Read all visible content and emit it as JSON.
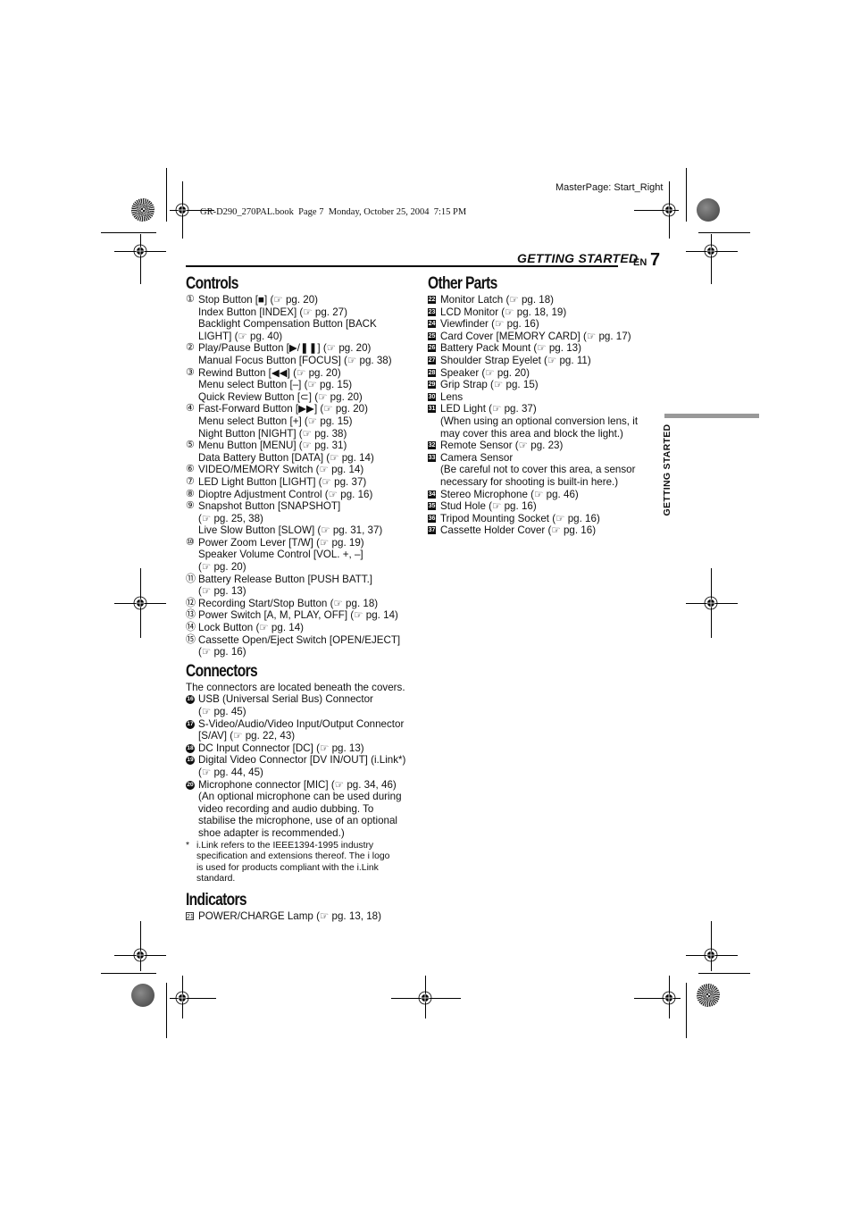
{
  "print_meta": {
    "masterpage": "MasterPage: Start_Right",
    "book_info": "GR-D290_270PAL.book  Page 7  Monday, October 25, 2004  7:15 PM"
  },
  "header": {
    "section": "GETTING STARTED",
    "lang": "EN",
    "page_number": "7"
  },
  "side_tab": {
    "label": "GETTING STARTED"
  },
  "ref_icon": "pointing-hand-icon",
  "controls": {
    "title": "Controls",
    "items": [
      {
        "num": "①",
        "lines": [
          "Stop Button [■] (☞ pg. 20)",
          "Index Button [INDEX] (☞ pg. 27)",
          "Backlight Compensation Button [BACK",
          "LIGHT] (☞ pg. 40)"
        ]
      },
      {
        "num": "②",
        "lines": [
          "Play/Pause Button [▶/❚❚] (☞ pg. 20)",
          "Manual Focus Button [FOCUS] (☞ pg. 38)"
        ]
      },
      {
        "num": "③",
        "lines": [
          "Rewind Button [◀◀] (☞ pg. 20)",
          "Menu select Button [–] (☞ pg. 15)",
          "Quick Review Button [⊂] (☞ pg. 20)"
        ]
      },
      {
        "num": "④",
        "lines": [
          "Fast-Forward Button [▶▶] (☞ pg. 20)",
          "Menu select Button [+] (☞ pg. 15)",
          "Night Button [NIGHT] (☞ pg. 38)"
        ]
      },
      {
        "num": "⑤",
        "lines": [
          "Menu Button [MENU] (☞ pg. 31)",
          "Data Battery Button [DATA] (☞ pg. 14)"
        ]
      },
      {
        "num": "⑥",
        "lines": [
          "VIDEO/MEMORY Switch (☞ pg. 14)"
        ]
      },
      {
        "num": "⑦",
        "lines": [
          "LED Light Button [LIGHT] (☞ pg. 37)"
        ]
      },
      {
        "num": "⑧",
        "lines": [
          "Dioptre Adjustment Control (☞ pg. 16)"
        ]
      },
      {
        "num": "⑨",
        "lines": [
          "Snapshot Button [SNAPSHOT]",
          "(☞ pg. 25, 38)",
          "Live Slow Button [SLOW] (☞ pg. 31, 37)"
        ]
      },
      {
        "num": "⑩",
        "lines": [
          "Power Zoom Lever [T/W] (☞ pg. 19)",
          "Speaker Volume Control [VOL. +, –]",
          "(☞ pg. 20)"
        ]
      },
      {
        "num": "⑪",
        "lines": [
          "Battery Release Button [PUSH BATT.]",
          "(☞ pg. 13)"
        ]
      },
      {
        "num": "⑫",
        "lines": [
          "Recording Start/Stop Button (☞ pg. 18)"
        ]
      },
      {
        "num": "⑬",
        "lines": [
          "Power Switch [A, M, PLAY, OFF] (☞ pg. 14)"
        ]
      },
      {
        "num": "⑭",
        "lines": [
          "Lock Button (☞ pg. 14)"
        ]
      },
      {
        "num": "⑮",
        "lines": [
          "Cassette Open/Eject Switch [OPEN/EJECT]",
          "(☞ pg. 16)"
        ]
      }
    ]
  },
  "connectors": {
    "title": "Connectors",
    "intro": "The connectors are located beneath the covers.",
    "items": [
      {
        "num": "16",
        "lines": [
          "USB (Universal Serial Bus) Connector",
          "(☞ pg. 45)"
        ]
      },
      {
        "num": "17",
        "lines": [
          "S-Video/Audio/Video Input/Output Connector",
          "[S/AV] (☞ pg. 22, 43)"
        ]
      },
      {
        "num": "18",
        "lines": [
          "DC Input Connector [DC] (☞ pg. 13)"
        ]
      },
      {
        "num": "19",
        "lines": [
          "Digital Video Connector [DV IN/OUT] (i.Link*)",
          "(☞ pg. 44, 45)"
        ]
      },
      {
        "num": "20",
        "lines": [
          "Microphone connector [MIC] (☞ pg. 34, 46)",
          "(An optional microphone can be used during",
          "video recording and audio dubbing. To",
          "stabilise the microphone, use of an optional",
          "shoe adapter is recommended.)"
        ]
      }
    ],
    "footnote": {
      "mark": "*",
      "lines": [
        "i.Link refers to the IEEE1394-1995 industry",
        "specification and extensions thereof. The i logo",
        "is used for products compliant with the i.Link",
        "standard."
      ]
    }
  },
  "indicators": {
    "title": "Indicators",
    "items": [
      {
        "num": "21",
        "lines": [
          "POWER/CHARGE Lamp (☞ pg. 13, 18)"
        ]
      }
    ]
  },
  "other_parts": {
    "title": "Other Parts",
    "items": [
      {
        "num": "22",
        "lines": [
          "Monitor Latch (☞ pg. 18)"
        ]
      },
      {
        "num": "23",
        "lines": [
          "LCD Monitor (☞ pg. 18, 19)"
        ]
      },
      {
        "num": "24",
        "lines": [
          "Viewfinder (☞ pg. 16)"
        ]
      },
      {
        "num": "25",
        "lines": [
          "Card Cover [MEMORY CARD] (☞ pg. 17)"
        ]
      },
      {
        "num": "26",
        "lines": [
          "Battery Pack Mount (☞ pg. 13)"
        ]
      },
      {
        "num": "27",
        "lines": [
          "Shoulder Strap Eyelet (☞ pg. 11)"
        ]
      },
      {
        "num": "28",
        "lines": [
          "Speaker (☞ pg. 20)"
        ]
      },
      {
        "num": "29",
        "lines": [
          "Grip Strap (☞ pg. 15)"
        ]
      },
      {
        "num": "30",
        "lines": [
          "Lens"
        ]
      },
      {
        "num": "31",
        "lines": [
          "LED Light (☞ pg. 37)",
          "(When using an optional conversion lens, it",
          "may cover this area and block the light.)"
        ]
      },
      {
        "num": "32",
        "lines": [
          "Remote Sensor (☞ pg. 23)"
        ]
      },
      {
        "num": "33",
        "lines": [
          "Camera Sensor",
          "(Be careful not to cover this area, a sensor",
          "necessary for shooting is built-in here.)"
        ]
      },
      {
        "num": "34",
        "lines": [
          "Stereo Microphone (☞ pg. 46)"
        ]
      },
      {
        "num": "35",
        "lines": [
          "Stud Hole (☞ pg. 16)"
        ]
      },
      {
        "num": "36",
        "lines": [
          "Tripod Mounting Socket (☞ pg. 16)"
        ]
      },
      {
        "num": "37",
        "lines": [
          "Cassette Holder Cover (☞ pg. 16)"
        ]
      }
    ]
  }
}
